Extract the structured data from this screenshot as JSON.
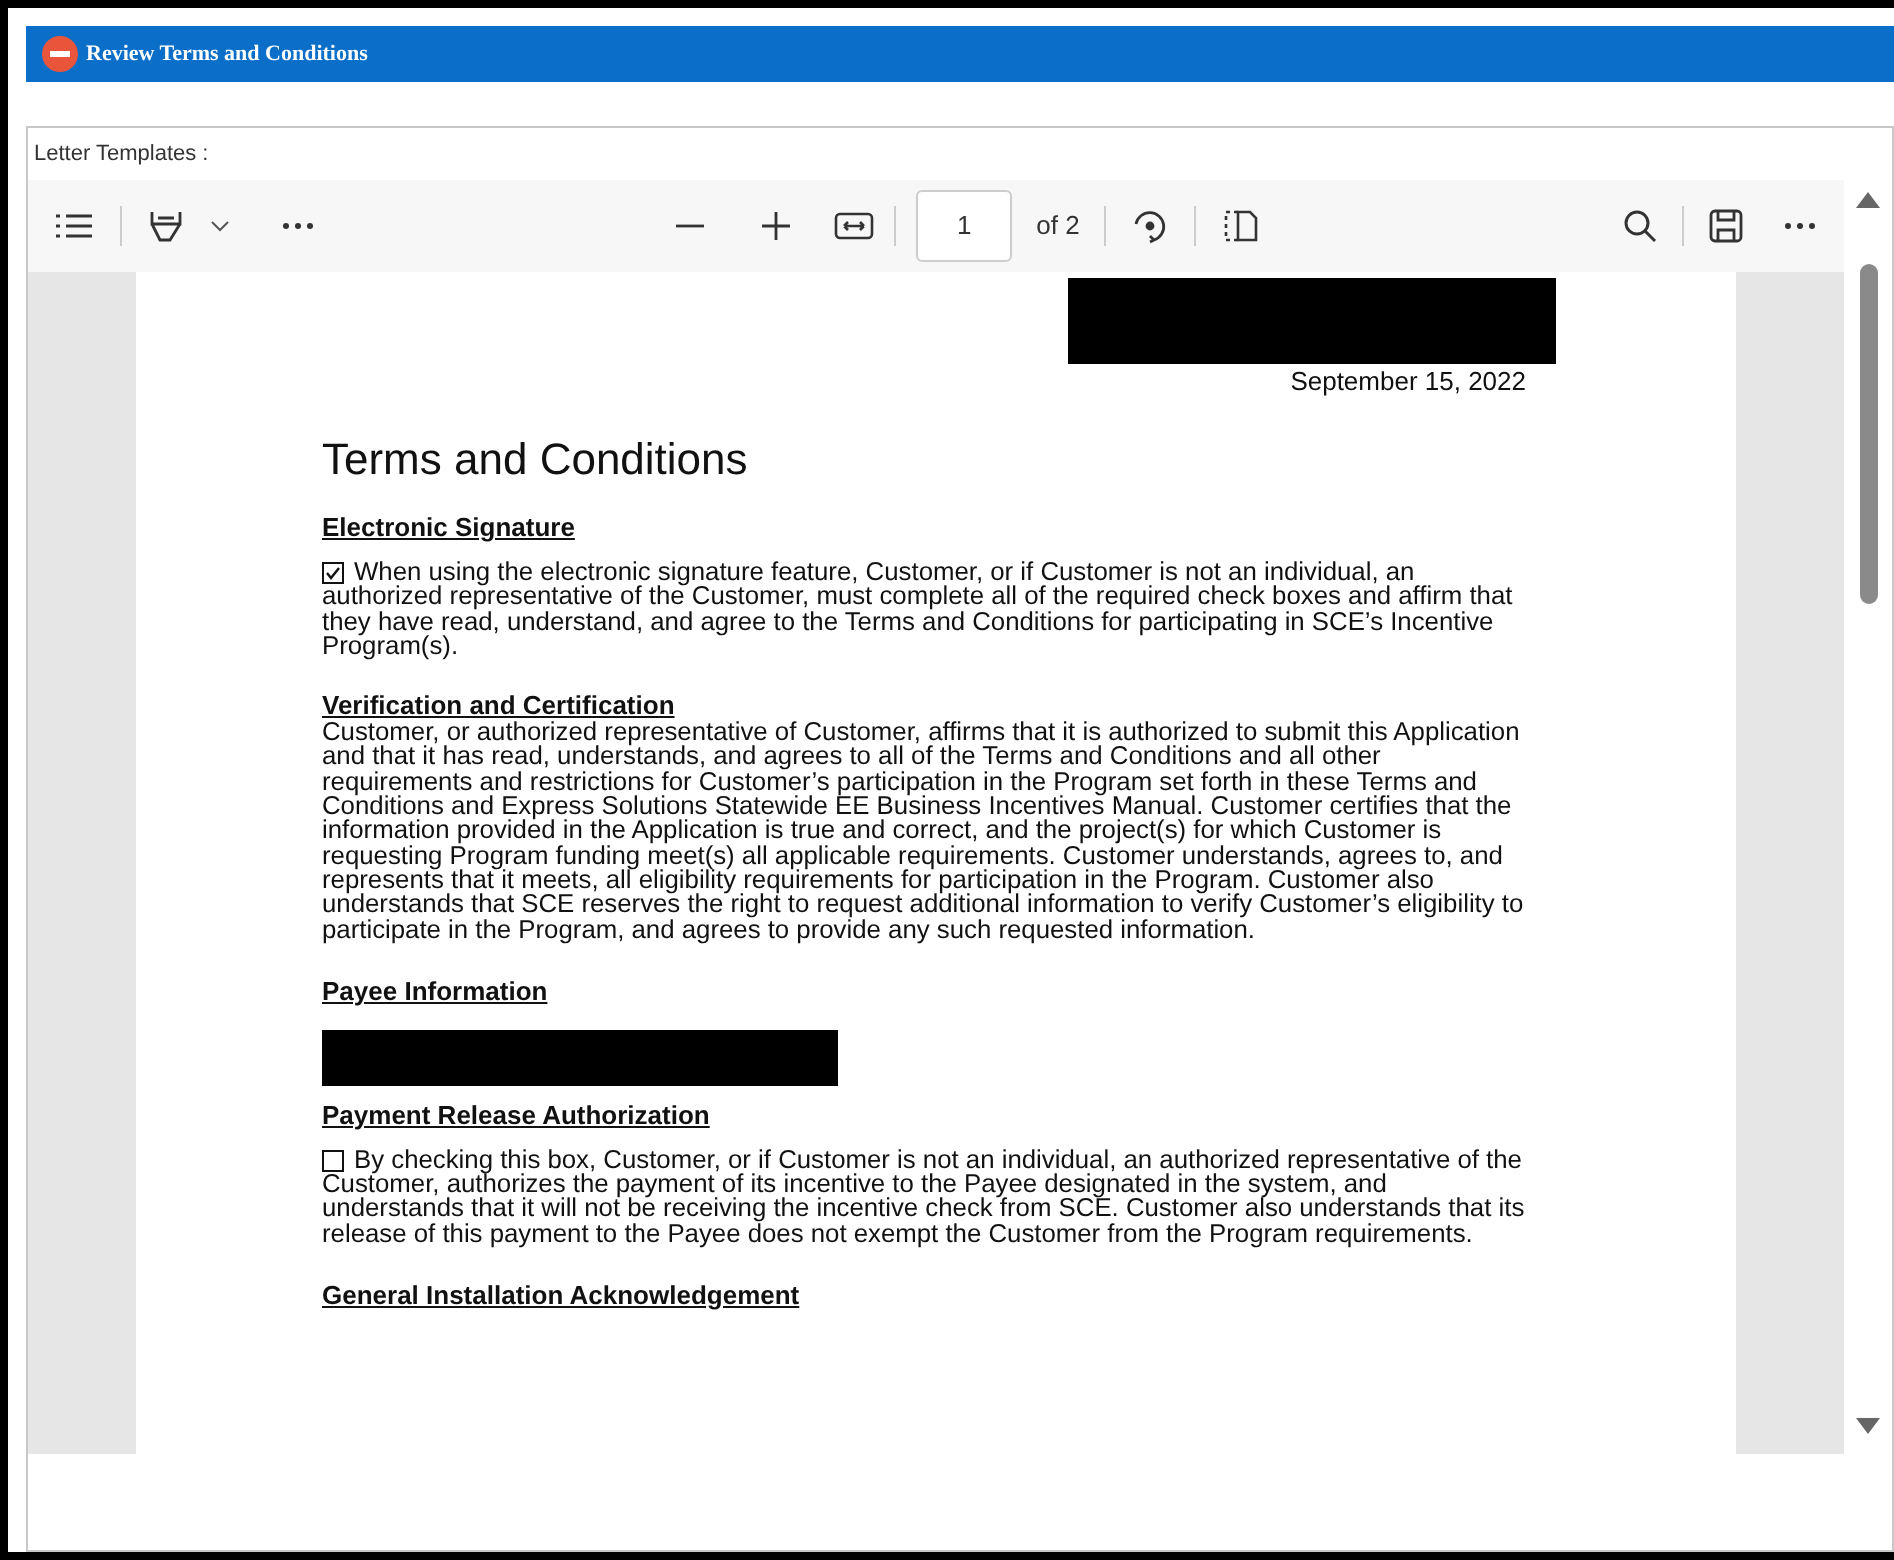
{
  "window": {
    "title": "Review Terms and Conditions"
  },
  "field_label": "Letter Templates :",
  "toolbar": {
    "page": "1",
    "page_count": "of 2"
  },
  "document": [
    {
      "kind": "redaction"
    },
    {
      "kind": "date",
      "text": "September 15, 2022"
    },
    {
      "kind": "title",
      "text": "Terms and Conditions"
    },
    {
      "kind": "heading",
      "text": "Electronic Signature"
    },
    {
      "kind": "check",
      "checked": true,
      "text": "When using the electronic signature feature, Customer, or if Customer is not an individual, an authorized representative of the Customer, must complete all of the required check boxes and affirm that they have read, understand, and agree to the Terms and Conditions for participating in SCE’s Incentive Program(s)."
    },
    {
      "kind": "heading_tight",
      "text": "Verification and Certification"
    },
    {
      "kind": "paragraph",
      "text": "Customer, or authorized representative of Customer, affirms that it is authorized to submit this Application and that it has read, understands, and agrees to all of the Terms and Conditions and all other requirements and restrictions for Customer’s participation in the Program set forth in these Terms and Conditions and Express Solutions Statewide EE Business Incentives Manual. Customer certifies that the information provided in the Application is true and correct, and the project(s) for which Customer is requesting Program funding meet(s) all applicable requirements. Customer understands, agrees to, and represents that it meets, all eligibility requirements for participation in the Program. Customer also understands that SCE reserves the right to request additional information to verify Customer’s eligibility to participate in the Program, and agrees to provide any such requested information."
    },
    {
      "kind": "heading",
      "text": "Payee Information"
    },
    {
      "kind": "redaction"
    },
    {
      "kind": "heading",
      "text": "Payment Release Authorization"
    },
    {
      "kind": "check",
      "checked": false,
      "text": "By checking this box, Customer, or if Customer is not an individual, an authorized representative of the Customer, authorizes the payment of its incentive to the Payee designated in the system, and understands that it will not be receiving the incentive check from SCE. Customer also understands that its release of this payment to the Payee does not exempt the Customer from the Program requirements."
    },
    {
      "kind": "heading",
      "text": "General Installation Acknowledgement"
    }
  ]
}
